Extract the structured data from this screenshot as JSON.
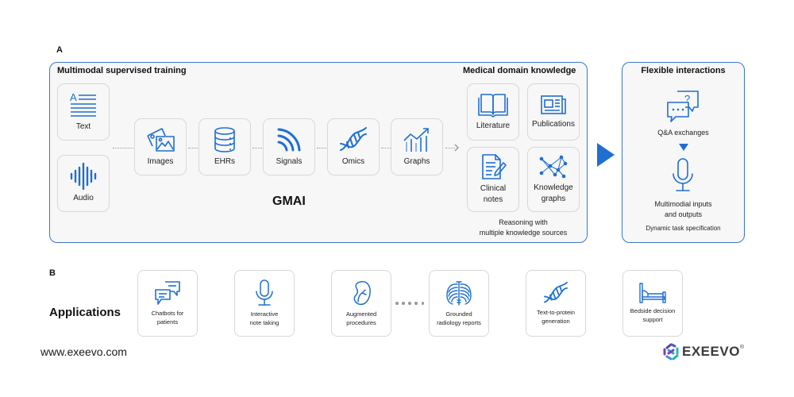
{
  "panel_a": {
    "letter": "A",
    "training": {
      "title": "Multimodal supervised training",
      "modalities": [
        {
          "label": "Text",
          "icon": "text-document-icon"
        },
        {
          "label": "Audio",
          "icon": "audio-waveform-icon"
        },
        {
          "label": "Images",
          "icon": "images-icon"
        },
        {
          "label": "EHRs",
          "icon": "database-icon"
        },
        {
          "label": "Signals",
          "icon": "signal-waves-icon"
        },
        {
          "label": "Omics",
          "icon": "dna-icon"
        },
        {
          "label": "Graphs",
          "icon": "bar-trend-chart-icon"
        }
      ],
      "center_label": "GMAI"
    },
    "knowledge": {
      "title": "Medical domain knowledge",
      "sources": [
        {
          "label": "Literature",
          "icon": "open-book-icon"
        },
        {
          "label": "Publications",
          "icon": "newspaper-icon"
        },
        {
          "label": "Clinical notes",
          "line1": "Clinical",
          "line2": "notes",
          "icon": "notes-pen-icon"
        },
        {
          "label": "Knowledge graphs",
          "line1": "Knowledge",
          "line2": "graphs",
          "icon": "network-graph-icon"
        }
      ],
      "caption_line1": "Reasoning with",
      "caption_line2": "multiple knowledge sources"
    },
    "interactions": {
      "title": "Flexible interactions",
      "qa_label": "Q&A exchanges",
      "io_line1": "Multimodial inputs",
      "io_line2": "and outputs",
      "task_label": "Dynamic task specification"
    }
  },
  "panel_b": {
    "letter": "B",
    "title": "Applications",
    "apps": [
      {
        "line1": "Chatbots for",
        "line2": "patients",
        "icon": "chat-bubbles-icon"
      },
      {
        "line1": "Interactive",
        "line2": "note taking",
        "icon": "microphone-icon"
      },
      {
        "line1": "Augmented",
        "line2": "procedures",
        "icon": "kidney-icon"
      },
      {
        "line1": "Grounded",
        "line2": "radiology reports",
        "icon": "ribcage-icon"
      },
      {
        "line1": "Text-to-protein",
        "line2": "generation",
        "icon": "dna-icon"
      },
      {
        "line1": "Bedside decision",
        "line2": "support",
        "icon": "bed-icon"
      }
    ]
  },
  "footer": {
    "website": "www.exeevo.com",
    "brand": "EXEEVO",
    "brand_mark": "®"
  },
  "colors": {
    "accent": "#1f6fd0",
    "panel_border": "#3a78c8",
    "card_border": "#d8d8d8",
    "panel_bg": "#f7f7f7"
  }
}
